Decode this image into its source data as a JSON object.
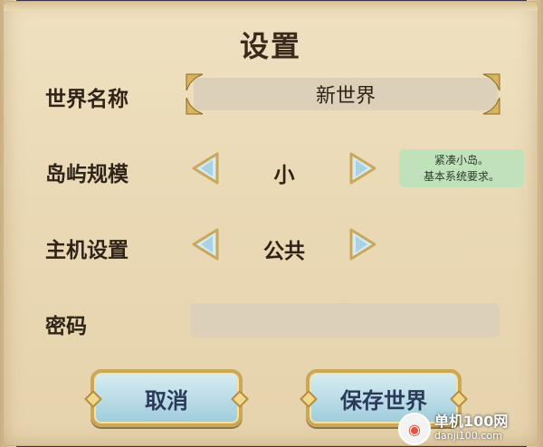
{
  "dialog": {
    "title": "设置"
  },
  "world_name": {
    "label": "世界名称",
    "value": "新世界"
  },
  "island_size": {
    "label": "岛屿规模",
    "value": "小",
    "tooltip_line1": "紧凑小岛。",
    "tooltip_line2": "基本系统要求。"
  },
  "host_settings": {
    "label": "主机设置",
    "value": "公共"
  },
  "password": {
    "label": "密码",
    "value": ""
  },
  "buttons": {
    "cancel": "取消",
    "save": "保存世界"
  },
  "watermark": {
    "main": "单机100网",
    "sub": "danji100.com"
  },
  "colors": {
    "parchment": "#efe1c1",
    "field": "#ddd0b8",
    "tooltip": "#bfe2bb",
    "button": "#b9dbe6",
    "gold_trim": "#c9a85a",
    "text": "#2f2418"
  }
}
